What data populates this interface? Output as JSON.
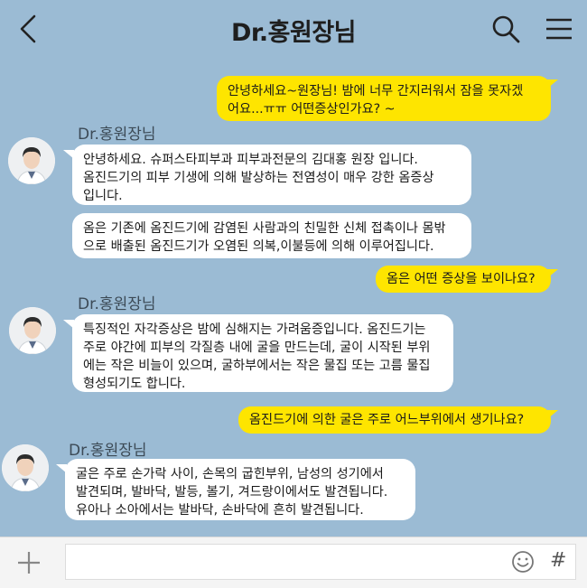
{
  "header": {
    "title": "Dr.홍원장님"
  },
  "messages": [
    {
      "sender": "me",
      "text": "안녕하세요~원장님! 밤에 너무 간지러워서 잠을 못자겠\n어요...ㅠㅠ 어떤증상인가요? ~"
    },
    {
      "sender": "them",
      "name": "Dr.홍원장님",
      "text": "안녕하세요. 슈퍼스타피부과 피부과전문의 김대홍 원장 입니다.\n옴진드기의 피부 기생에 의해 발상하는 전염성이 매우 강한 옴증상\n입니다."
    },
    {
      "sender": "them",
      "text": "옴은 기존에 옴진드기에 감염된 사람과의 친밀한 신체 접촉이나 몸밖\n으로 배출된 옴진드기가 오염된 의복,이불등에 의해 이루어집니다."
    },
    {
      "sender": "me",
      "text": "옴은 어떤 증상을 보이나요?"
    },
    {
      "sender": "them",
      "name": "Dr.홍원장님",
      "text": "특징적인 자각증상은 밤에 심해지는 가려움증입니다. 옴진드기는\n주로 야간에 피부의 각질층 내에 굴을 만드는데, 굴이 시작된  부위\n에는 작은 비늘이 있으며, 굴하부에서는 작은 물집 또는 고름 물집\n형성되기도 합니다."
    },
    {
      "sender": "me",
      "text": "옴진드기에 의한 굴은 주로 어느부위에서 생기나요?"
    },
    {
      "sender": "them",
      "name": "Dr.홍원장님",
      "text": "굴은 주로 손가락 사이, 손목의 굽힌부위, 남성의 성기에서\n발견되며, 발바닥, 발등, 볼기, 겨드랑이에서도 발견됩니다.\n유아나 소아에서는 발바닥, 손바닥에 흔히 발견됩니다."
    }
  ],
  "input": {
    "placeholder": "",
    "send_label": "#"
  },
  "colors": {
    "background": "#9bbbd4",
    "my_bubble": "#fee500",
    "their_bubble": "#ffffff"
  }
}
